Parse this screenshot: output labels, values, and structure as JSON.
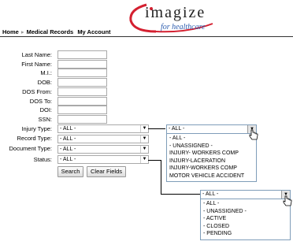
{
  "brand": {
    "name": "imagize",
    "tagline": "for healthcare"
  },
  "nav": {
    "home": "Home",
    "medical_records": "Medical Records",
    "my_account": "My Account"
  },
  "form": {
    "last_name": "Last Name:",
    "first_name": "First Name:",
    "mi": "M.I.:",
    "dob": "DOB:",
    "dos_from": "DOS From:",
    "dos_to": "DOS To:",
    "doi": "DOI:",
    "ssn": "SSN:",
    "injury_type": "Injury Type:",
    "record_type": "Record Type:",
    "document_type": "Document Type:",
    "status": "Status:"
  },
  "selects": {
    "injury_type": "- ALL -",
    "record_type": "- ALL -",
    "document_type": "- ALL -",
    "status": "- ALL -"
  },
  "buttons": {
    "search": "Search",
    "clear": "Clear Fields"
  },
  "injury_dropdown": {
    "selected": "- ALL -",
    "options": [
      "- ALL -",
      "- UNASSIGNED -",
      "INJURY- WORKERS COMP",
      "INJURY-LACERATION",
      "INJURY-WORKERS COMP",
      "MOTOR VEHICLE ACCIDENT"
    ]
  },
  "status_dropdown": {
    "selected": "- ALL -",
    "options": [
      "- ALL -",
      "- UNASSIGNED -",
      "- ACTIVE",
      "- CLOSED",
      "- PENDING"
    ]
  },
  "colors": {
    "brand_red": "#d42030",
    "tagline_blue": "#2f5fb0",
    "dropdown_border": "#7f9db9"
  }
}
